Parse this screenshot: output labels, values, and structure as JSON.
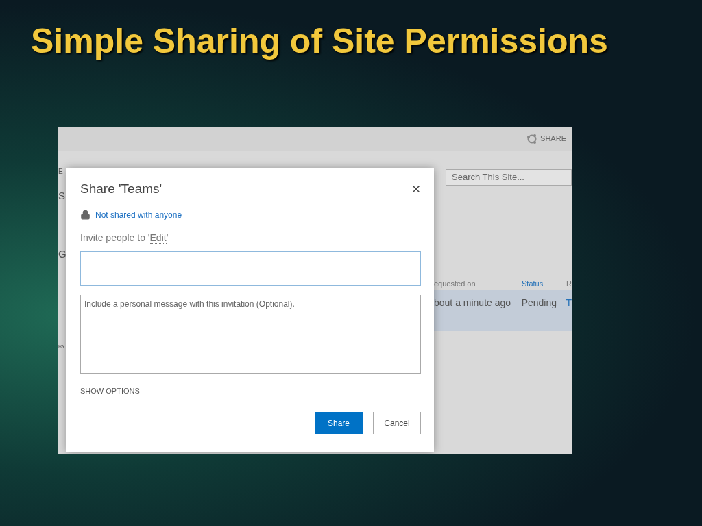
{
  "slide_title": "Simple Sharing of Site Permissions",
  "page": {
    "share_link": "SHARE",
    "search": {
      "placeholder": "Search This Site..."
    },
    "left_fragments": [
      "E",
      "S",
      "G",
      "RY"
    ],
    "table": {
      "columns": [
        {
          "label": "equested on",
          "kind": "plain"
        },
        {
          "label": "Status",
          "kind": "link"
        },
        {
          "label": "R",
          "kind": "plain"
        }
      ],
      "rows": [
        {
          "selected": true,
          "cells": [
            {
              "text": "bout a minute ago",
              "kind": "plain"
            },
            {
              "text": "Pending",
              "kind": "plain"
            },
            {
              "text": "T",
              "kind": "link"
            }
          ]
        }
      ]
    }
  },
  "dialog": {
    "title": "Share 'Teams'",
    "sharing_status": "Not shared with anyone",
    "invite": {
      "before": "Invite people to '",
      "link": "Edit",
      "after": "'"
    },
    "message": {
      "placeholder": "Include a personal message with this invitation (Optional)."
    },
    "show_options": "SHOW OPTIONS",
    "buttons": [
      {
        "label": "Share",
        "kind": "primary"
      },
      {
        "label": "Cancel",
        "kind": "secondary"
      }
    ]
  }
}
